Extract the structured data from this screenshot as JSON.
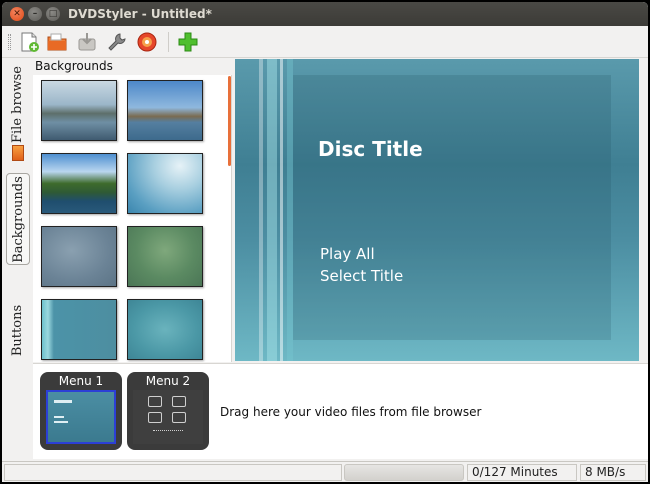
{
  "window": {
    "title": "DVDStyler - Untitled*"
  },
  "sidebar": {
    "tabs": [
      {
        "label": "File browse"
      },
      {
        "label": "Backgrounds"
      },
      {
        "label": "Buttons"
      }
    ]
  },
  "backgrounds": {
    "title": "Backgrounds"
  },
  "preview": {
    "disc_title": "Disc Title",
    "items": [
      "Play All",
      "Select Title"
    ]
  },
  "menus": {
    "items": [
      {
        "label": "Menu 1"
      },
      {
        "label": "Menu 2"
      }
    ],
    "drag_hint": "Drag here your video files from file browser"
  },
  "status": {
    "minutes": "0/127 Minutes",
    "rate": "8 MB/s",
    "progress": 0
  },
  "colors": {
    "accent_orange": "#e8703a",
    "preview_teal": "#4c8ea2",
    "titlebar": "#3c3b37"
  }
}
